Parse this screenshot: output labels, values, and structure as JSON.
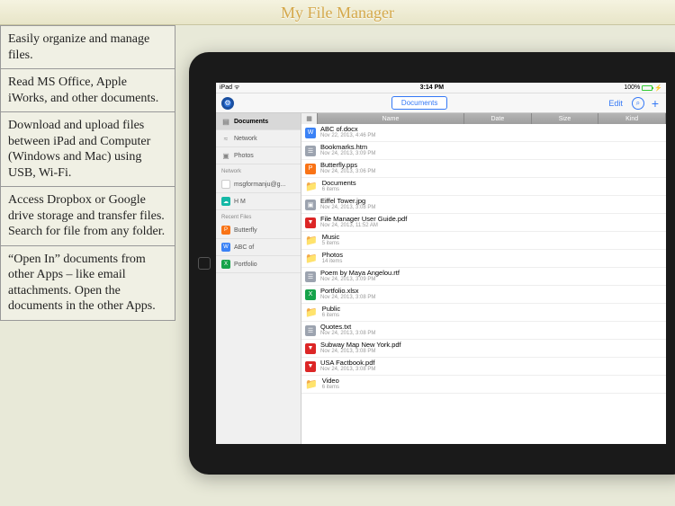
{
  "title": "My File Manager",
  "features": [
    "Easily organize and manage files.",
    "Read MS Office, Apple iWorks, and other documents.",
    "Download and upload files between iPad and Computer (Windows and Mac) using USB, Wi-Fi.",
    "Access Dropbox or Google drive storage and transfer files. Search for file from any folder.",
    "“Open In” documents from other Apps – like email attachments. Open the documents in the other Apps."
  ],
  "status": {
    "carrier": "iPad",
    "wifi": "●",
    "time": "3:14 PM",
    "battery": "100%"
  },
  "toolbar": {
    "documents": "Documents",
    "edit": "Edit"
  },
  "sidebar": {
    "main": [
      {
        "label": "Documents",
        "icon": "▤",
        "selected": true
      },
      {
        "label": "Network",
        "icon": "≈",
        "selected": false
      },
      {
        "label": "Photos",
        "icon": "▣",
        "selected": false
      }
    ],
    "network_header": "Network",
    "network": [
      {
        "label": "msgformanju@g...",
        "iconColor": "c-drive",
        "glyph": "△"
      },
      {
        "label": "H M",
        "iconColor": "c-teal",
        "glyph": "☁"
      }
    ],
    "recent_header": "Recent Files",
    "recent": [
      {
        "label": "Butterfly",
        "iconColor": "c-orange",
        "glyph": "P"
      },
      {
        "label": "ABC of",
        "iconColor": "c-blue",
        "glyph": "W"
      },
      {
        "label": "Portfolio",
        "iconColor": "c-green",
        "glyph": "X"
      }
    ]
  },
  "columns": {
    "name": "Name",
    "date": "Date",
    "size": "Size",
    "kind": "Kind"
  },
  "files": [
    {
      "name": "ABC of.docx",
      "meta": "Nov 22, 2013, 4:46 PM",
      "type": "file",
      "iconColor": "c-blue",
      "glyph": "W"
    },
    {
      "name": "Bookmarks.htm",
      "meta": "Nov 24, 2013, 3:09 PM",
      "type": "file",
      "iconColor": "c-gray",
      "glyph": "☰"
    },
    {
      "name": "Butterfly.pps",
      "meta": "Nov 24, 2013, 3:06 PM",
      "type": "file",
      "iconColor": "c-orange",
      "glyph": "P"
    },
    {
      "name": "Documents",
      "meta": "6 items",
      "type": "folder"
    },
    {
      "name": "Eiffel Tower.jpg",
      "meta": "Nov 24, 2013, 3:08 PM",
      "type": "file",
      "iconColor": "c-gray",
      "glyph": "▣"
    },
    {
      "name": "File Manager User Guide.pdf",
      "meta": "Nov 24, 2013, 11:52 AM",
      "type": "file",
      "iconColor": "c-red",
      "glyph": "▼"
    },
    {
      "name": "Music",
      "meta": "5 items",
      "type": "folder"
    },
    {
      "name": "Photos",
      "meta": "14 items",
      "type": "folder"
    },
    {
      "name": "Poem by Maya Angelou.rtf",
      "meta": "Nov 24, 2013, 3:09 PM",
      "type": "file",
      "iconColor": "c-gray",
      "glyph": "☰"
    },
    {
      "name": "Portfolio.xlsx",
      "meta": "Nov 24, 2013, 3:08 PM",
      "type": "file",
      "iconColor": "c-green",
      "glyph": "X"
    },
    {
      "name": "Public",
      "meta": "6 items",
      "type": "folder"
    },
    {
      "name": "Quotes.txt",
      "meta": "Nov 24, 2013, 3:08 PM",
      "type": "file",
      "iconColor": "c-gray",
      "glyph": "☰"
    },
    {
      "name": "Subway Map New York.pdf",
      "meta": "Nov 24, 2013, 3:08 PM",
      "type": "file",
      "iconColor": "c-red",
      "glyph": "▼"
    },
    {
      "name": "USA Factbook.pdf",
      "meta": "Nov 24, 2013, 3:08 PM",
      "type": "file",
      "iconColor": "c-red",
      "glyph": "▼"
    },
    {
      "name": "Video",
      "meta": "6 items",
      "type": "folder"
    }
  ]
}
